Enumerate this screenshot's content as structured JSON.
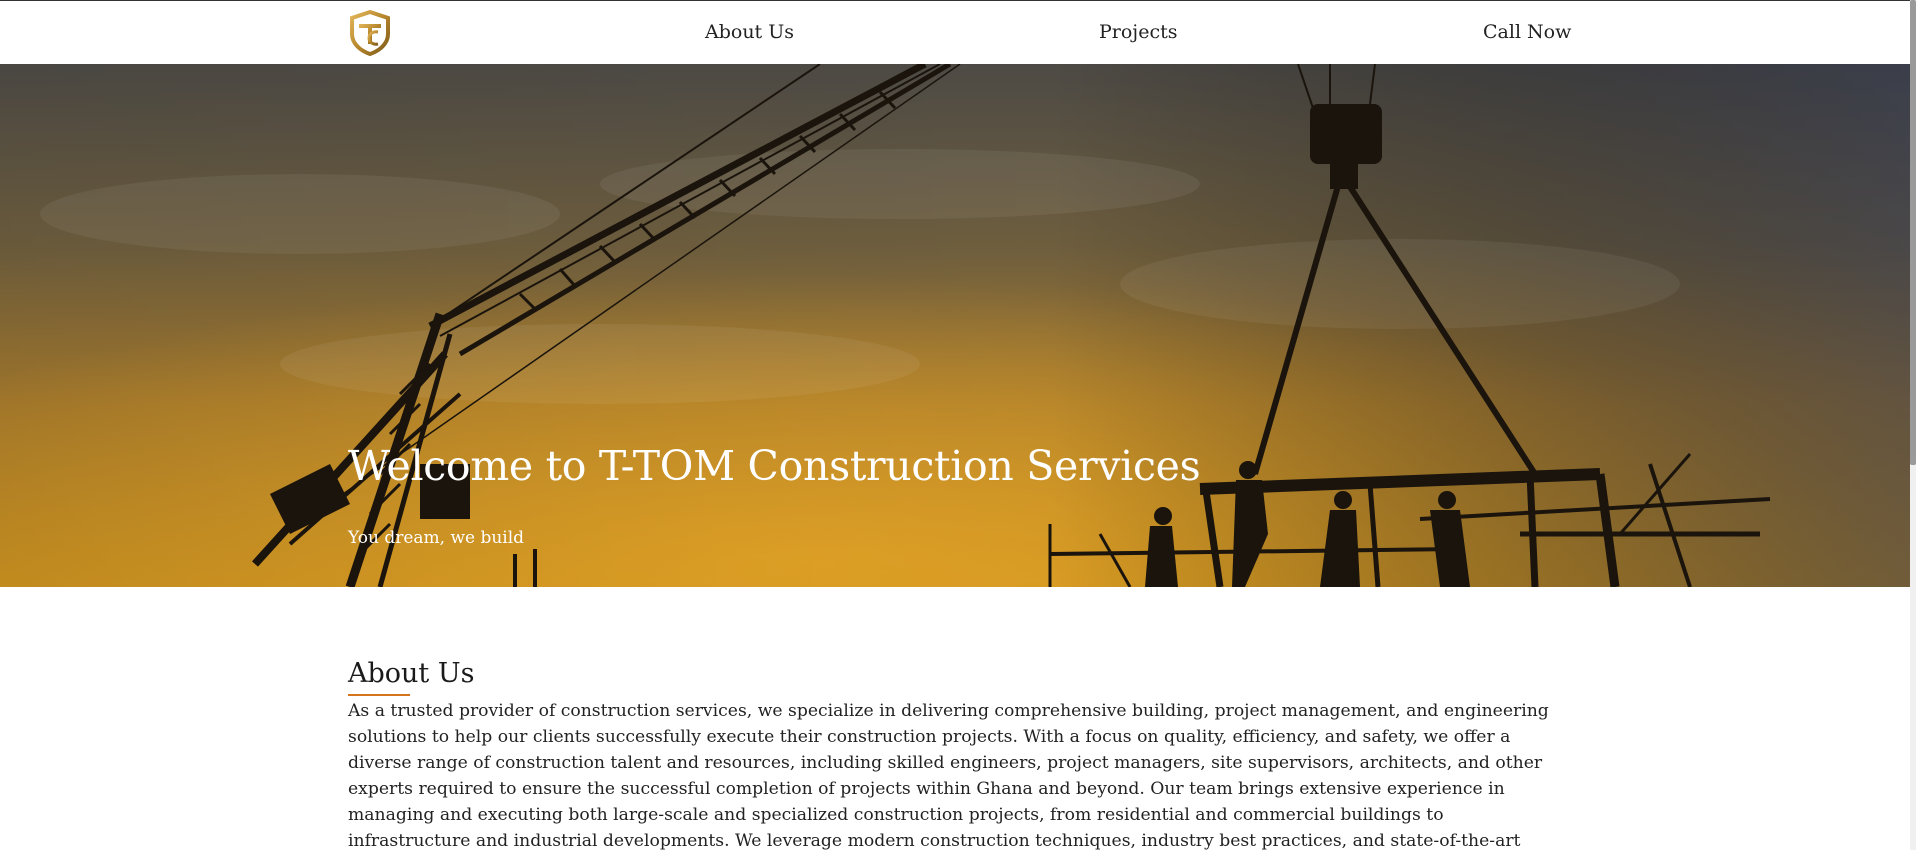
{
  "header": {
    "logo_icon": "tc-shield-logo-icon",
    "nav": {
      "about": "About Us",
      "projects": "Projects",
      "call": "Call Now"
    }
  },
  "hero": {
    "title": "Welcome to T-TOM Construction Services",
    "subtitle": "You dream, we build",
    "background": "construction-crane-sunset-image"
  },
  "about": {
    "title": "About Us",
    "text": "As a trusted provider of construction services, we specialize in delivering comprehensive building, project management, and engineering solutions to help our clients successfully execute their construction projects. With a focus on quality, efficiency, and safety, we offer a diverse range of construction talent and resources, including skilled engineers, project managers, site supervisors, architects, and other experts required to ensure the successful completion of projects within Ghana and beyond. Our team brings extensive experience in managing and executing both large-scale and specialized construction projects, from residential and commercial buildings to infrastructure and industrial developments. We leverage modern construction techniques, industry best practices, and state-of-the-art"
  },
  "colors": {
    "accent": "#d4741c",
    "logo_gold": "#c9962e",
    "text": "#222222"
  }
}
